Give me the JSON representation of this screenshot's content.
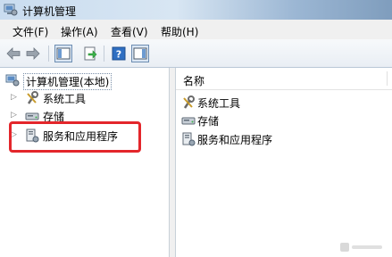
{
  "window": {
    "title": "计算机管理"
  },
  "menu": [
    "文件(F)",
    "操作(A)",
    "查看(V)",
    "帮助(H)"
  ],
  "toolbar": {
    "icons": [
      "back-icon",
      "forward-icon",
      "show-hide-tree-icon",
      "export-list-icon",
      "help-icon",
      "show-hide-action-pane-icon"
    ]
  },
  "tree": {
    "root": "计算机管理(本地)",
    "items": [
      "系统工具",
      "存储",
      "服务和应用程序"
    ],
    "highlighted_item": "服务和应用程序",
    "highlight_color": "#e3262b"
  },
  "list": {
    "column_header": "名称",
    "items": [
      "系统工具",
      "存储",
      "服务和应用程序"
    ]
  }
}
